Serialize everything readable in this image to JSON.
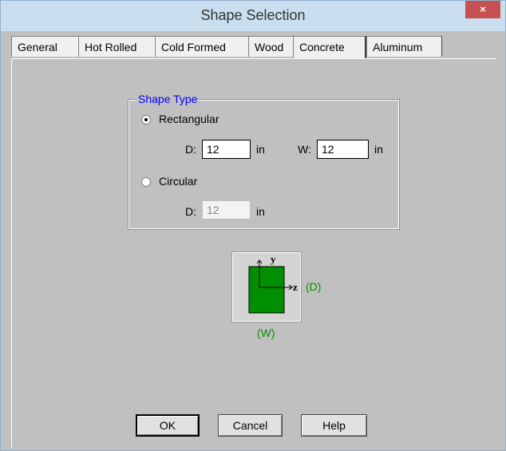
{
  "window": {
    "title": "Shape Selection",
    "close_glyph": "×"
  },
  "tabs": [
    {
      "label": "General"
    },
    {
      "label": "Hot Rolled"
    },
    {
      "label": "Cold Formed"
    },
    {
      "label": "Wood"
    },
    {
      "label": "Concrete",
      "active": true
    },
    {
      "label": "Aluminum"
    }
  ],
  "shape_type": {
    "legend": "Shape Type",
    "rectangular": {
      "label": "Rectangular",
      "selected": true,
      "d_label": "D:",
      "d_value": "12",
      "d_unit": "in",
      "w_label": "W:",
      "w_value": "12",
      "w_unit": "in"
    },
    "circular": {
      "label": "Circular",
      "selected": false,
      "d_label": "D:",
      "d_value": "12",
      "d_unit": "in"
    }
  },
  "preview": {
    "y_axis": "y",
    "z_axis": "z",
    "d_label": "(D)",
    "w_label": "(W)",
    "fill_color": "#008f00"
  },
  "buttons": {
    "ok": "OK",
    "cancel": "Cancel",
    "help": "Help"
  }
}
